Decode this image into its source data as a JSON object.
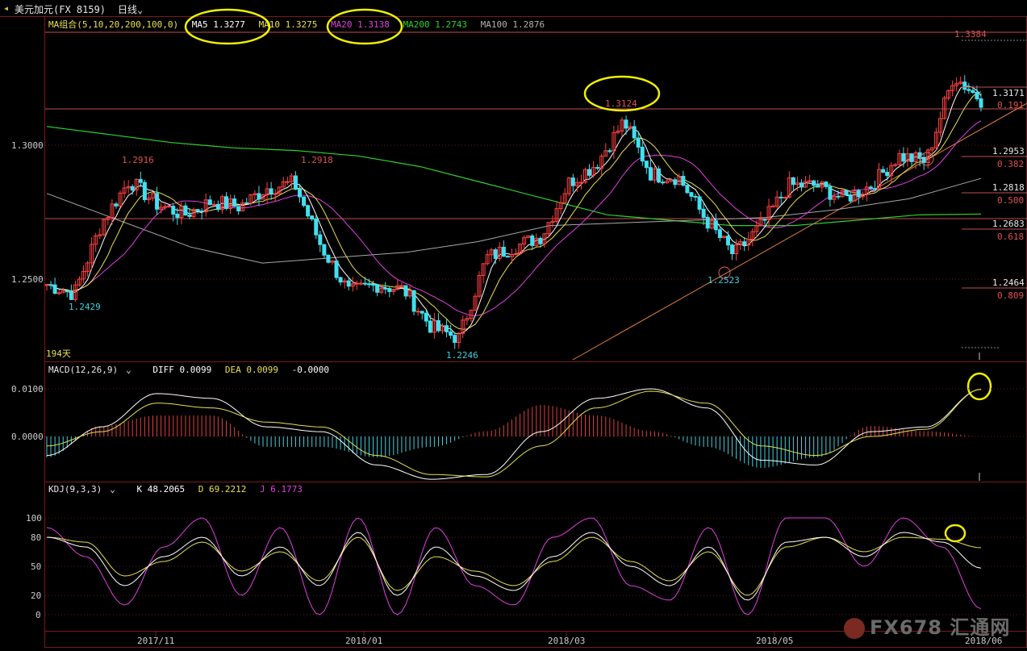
{
  "window": {
    "symbol": "美元加元(FX 8159)",
    "period": "日线",
    "period_chevron": "chevron-down-icon"
  },
  "ma_legend": {
    "group": "MA组合(5,10,20,200,100,0)",
    "ma5": "MA5 1.3277",
    "ma10": "MA10 1.3275",
    "ma20": "MA20 1.3138",
    "ma200": "MA200 1.2743",
    "ma100": "MA100 1.2876",
    "colors": {
      "ma5": "#ffffff",
      "ma10": "#e8e050",
      "ma20": "#e040e0",
      "ma200": "#30d030",
      "ma100": "#b0b0b0"
    }
  },
  "macd_legend": {
    "title": "MACD(12,26,9)",
    "diff": "DIFF 0.0099",
    "dea": "DEA 0.0099",
    "macd": "-0.0000"
  },
  "kdj_legend": {
    "title": "KDJ(9,3,3)",
    "k": "K 48.2065",
    "d": "D 69.2212",
    "j": "J 6.1773"
  },
  "annotations": {
    "bars_count": "194天",
    "hi_1": "1.2916",
    "hi_2": "1.2918",
    "lo_1": "1.2429",
    "lo_2": "1.2246",
    "peak_mar": "1.3124",
    "lo_apr": "1.2523",
    "top": "1.3384"
  },
  "fib_levels": [
    {
      "price": "1.3171",
      "ratio": "0.191"
    },
    {
      "price": "1.2953",
      "ratio": "0.382"
    },
    {
      "price": "1.2818",
      "ratio": "0.500"
    },
    {
      "price": "1.2683",
      "ratio": "0.618"
    },
    {
      "price": "1.2464",
      "ratio": "0.809"
    }
  ],
  "watermark": "FX678 汇通网",
  "chart_data": [
    {
      "type": "candlestick",
      "title": "美元加元(FX 8159) 日线",
      "ylim": [
        1.215,
        1.342
      ],
      "y_ticks": [
        {
          "value": 1.3,
          "label": "1.3000"
        },
        {
          "value": 1.25,
          "label": "1.2500"
        }
      ],
      "x_ticks": [
        "2017/11",
        "2018/01",
        "2018/03",
        "2018/05",
        "2018/06"
      ],
      "close_path_points": [
        [
          "2017-10-20",
          1.248
        ],
        [
          "2017-10-27",
          1.2445
        ],
        [
          "2017-11-03",
          1.271
        ],
        [
          "2017-11-10",
          1.287
        ],
        [
          "2017-11-17",
          1.278
        ],
        [
          "2017-11-24",
          1.274
        ],
        [
          "2017-12-01",
          1.279
        ],
        [
          "2017-12-08",
          1.277
        ],
        [
          "2017-12-15",
          1.284
        ],
        [
          "2017-12-22",
          1.286
        ],
        [
          "2017-12-29",
          1.262
        ],
        [
          "2018-01-05",
          1.245
        ],
        [
          "2018-01-12",
          1.248
        ],
        [
          "2018-01-19",
          1.246
        ],
        [
          "2018-01-26",
          1.232
        ],
        [
          "2018-02-02",
          1.228
        ],
        [
          "2018-02-09",
          1.258
        ],
        [
          "2018-02-16",
          1.262
        ],
        [
          "2018-02-23",
          1.266
        ],
        [
          "2018-03-02",
          1.286
        ],
        [
          "2018-03-09",
          1.293
        ],
        [
          "2018-03-16",
          1.309
        ],
        [
          "2018-03-23",
          1.289
        ],
        [
          "2018-03-30",
          1.288
        ],
        [
          "2018-04-06",
          1.272
        ],
        [
          "2018-04-13",
          1.259
        ],
        [
          "2018-04-20",
          1.27
        ],
        [
          "2018-04-27",
          1.285
        ],
        [
          "2018-05-04",
          1.285
        ],
        [
          "2018-05-11",
          1.28
        ],
        [
          "2018-05-18",
          1.285
        ],
        [
          "2018-05-25",
          1.296
        ],
        [
          "2018-06-01",
          1.294
        ],
        [
          "2018-06-08",
          1.326
        ],
        [
          "2018-06-13",
          1.317
        ]
      ],
      "ma_lines": {
        "MA200": [
          1.307,
          1.304,
          1.301,
          1.299,
          1.298,
          1.296,
          1.292,
          1.286,
          1.28,
          1.274,
          1.272,
          1.27,
          1.27,
          1.272,
          1.274,
          1.2743
        ],
        "MA100": [
          1.282,
          1.272,
          1.262,
          1.256,
          1.258,
          1.26,
          1.264,
          1.27,
          1.271,
          1.272,
          1.273,
          1.276,
          1.28,
          1.2876
        ]
      }
    },
    {
      "type": "macd",
      "y_ticks": [
        {
          "value": 0.01,
          "label": "0.0100"
        },
        {
          "value": 0.0,
          "label": "0.0000"
        }
      ],
      "ylim": [
        -0.0095,
        0.0145
      ],
      "diff": [
        -0.004,
        0.002,
        0.009,
        0.008,
        0.002,
        0.001,
        -0.006,
        -0.009,
        -0.008,
        0.001,
        0.008,
        0.01,
        0.006,
        -0.005,
        -0.006,
        0.001,
        0.002,
        0.0099
      ],
      "dea": [
        -0.002,
        0.001,
        0.007,
        0.006,
        0.003,
        0.002,
        -0.004,
        -0.008,
        -0.0085,
        -0.002,
        0.006,
        0.0095,
        0.007,
        -0.002,
        -0.004,
        0.0,
        0.0015,
        0.0099
      ]
    },
    {
      "type": "kdj",
      "y_ticks": [
        {
          "value": 100,
          "label": "100"
        },
        {
          "value": 80,
          "label": "80"
        },
        {
          "value": 50,
          "label": "50"
        },
        {
          "value": 20,
          "label": "20"
        },
        {
          "value": 0,
          "label": "0"
        }
      ],
      "ylim": [
        -10,
        115
      ],
      "k": [
        80,
        70,
        30,
        60,
        80,
        40,
        70,
        30,
        85,
        20,
        70,
        40,
        25,
        60,
        85,
        50,
        30,
        70,
        15,
        75,
        80,
        60,
        85,
        75,
        48.2065
      ],
      "d": [
        80,
        75,
        40,
        55,
        75,
        45,
        65,
        35,
        80,
        25,
        60,
        45,
        30,
        55,
        80,
        55,
        35,
        65,
        20,
        70,
        80,
        65,
        80,
        78,
        69.2212
      ],
      "j": [
        90,
        60,
        10,
        70,
        100,
        20,
        90,
        0,
        100,
        0,
        90,
        30,
        10,
        80,
        100,
        30,
        15,
        90,
        0,
        100,
        100,
        50,
        100,
        70,
        6.1773
      ]
    }
  ]
}
